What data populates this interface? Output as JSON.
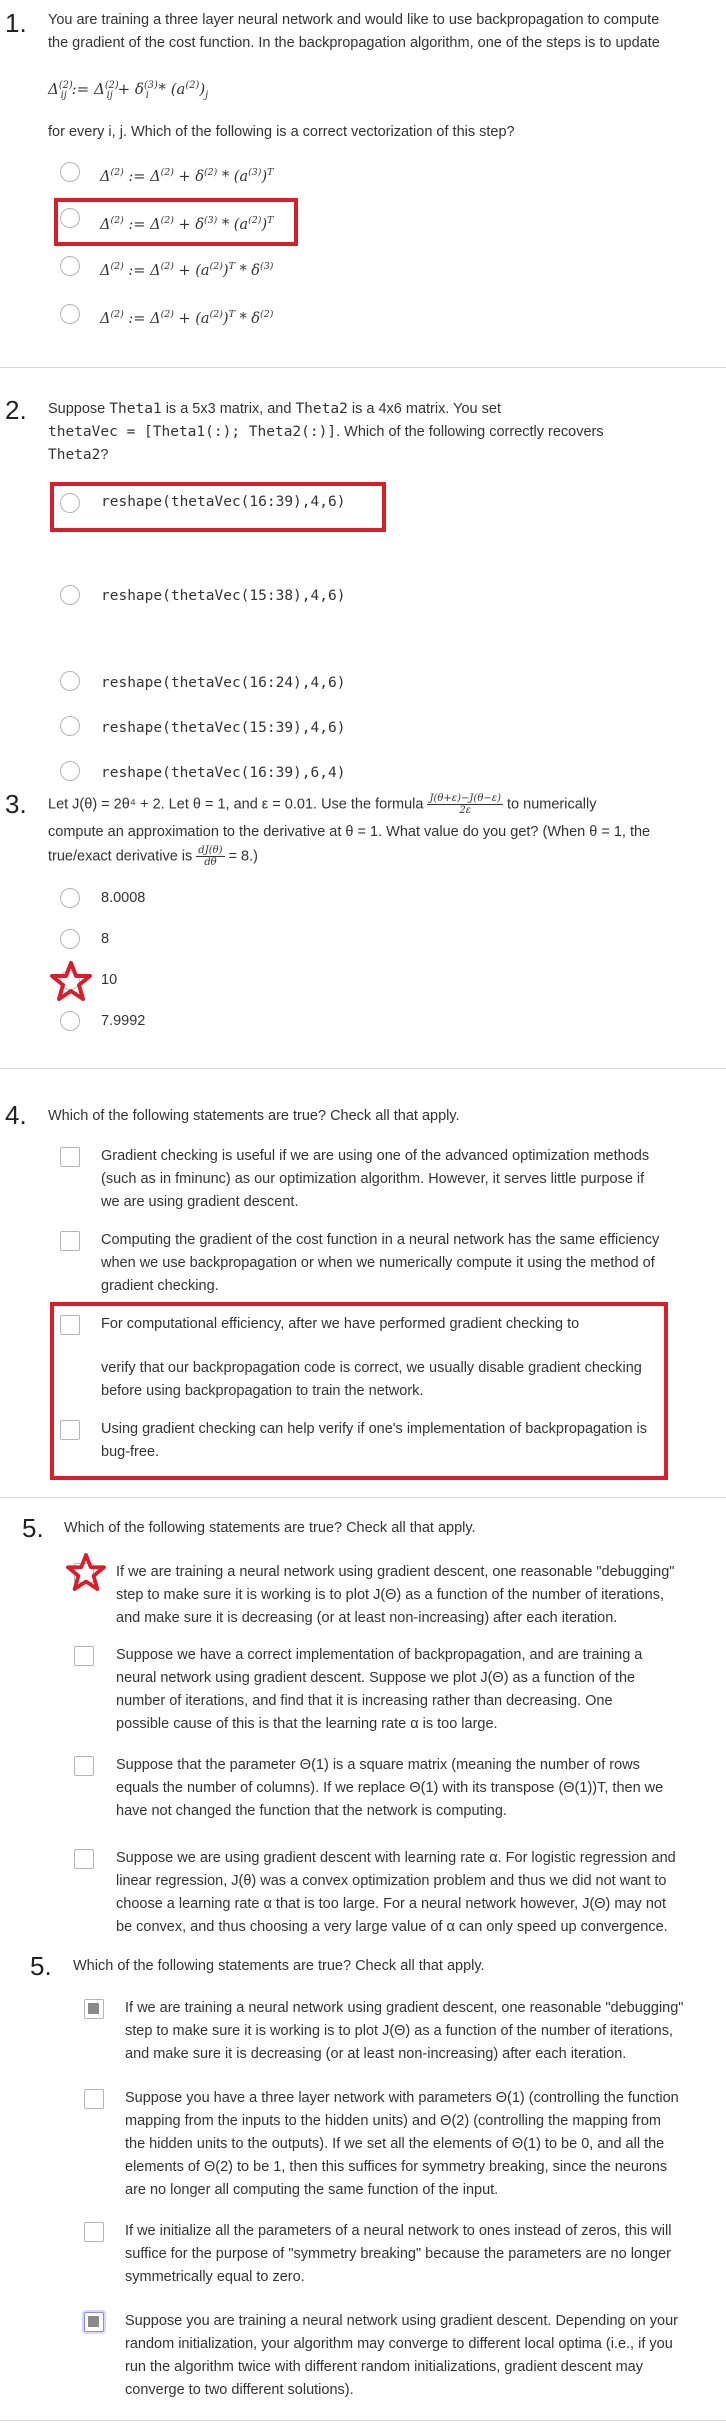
{
  "q1": {
    "number": "1.",
    "text_line1": "You are training a three layer neural network and would like to use backpropagation to compute",
    "text_line2": "the gradient of the cost function. In the backpropagation algorithm, one of the steps is to update",
    "formula": "Δij(2) := Δij(2) + δi(3) * (a(2))j",
    "prompt": "for every i, j. Which of the following is a correct vectorization of this step?",
    "options": [
      "Δ(2) := Δ(2) + δ(2) * (a(3))T",
      "Δ(2) := Δ(2) + δ(3) * (a(2))T",
      "Δ(2) := Δ(2) + (a(2))T * δ(3)",
      "Δ(2) := Δ(2) + (a(2))T * δ(2)"
    ]
  },
  "q2": {
    "number": "2.",
    "line1_a": "Suppose ",
    "line1_code1": "Theta1",
    "line1_b": " is a 5x3 matrix, and ",
    "line1_code2": "Theta2",
    "line1_c": " is a 4x6 matrix. You set",
    "line2_code": "thetaVec = [Theta1(:); Theta2(:)]",
    "line2_rest": ". Which of the following correctly recovers",
    "line3_code": "Theta2",
    "line3_rest": "?",
    "options": [
      "reshape(thetaVec(16:39),4,6)",
      "reshape(thetaVec(15:38),4,6)",
      "reshape(thetaVec(16:24),4,6)",
      "reshape(thetaVec(15:39),4,6)",
      "reshape(thetaVec(16:39),6,4)"
    ]
  },
  "q3": {
    "number": "3.",
    "line1_a": "Let J(θ) = 2θ⁴ + 2. Let θ = 1, and ε = 0.01. Use the formula",
    "line1_b": "to numerically",
    "line2": "compute an approximation to the derivative at θ = 1. What value do you get? (When θ = 1, the",
    "line3_a": "true/exact derivative is",
    "line3_b": "= 8.)",
    "options": [
      "8.0008",
      "8",
      "10",
      "7.9992"
    ]
  },
  "q4": {
    "number": "4.",
    "text": "Which of the following statements are true? Check all that apply.",
    "options": [
      [
        "Gradient checking is useful if we are using one of the advanced optimization methods",
        "(such as in fminunc) as our optimization algorithm. However, it serves little purpose if",
        "we are using gradient descent."
      ],
      [
        "Computing the gradient of the cost function in a neural network has the same efficiency",
        "when we use backpropagation or when we numerically compute it using the method of",
        "gradient checking."
      ],
      [
        "For computational efficiency, after we have performed gradient checking to"
      ],
      [
        "verify that our backpropagation code is correct, we usually disable gradient checking",
        "before using backpropagation to train the network."
      ],
      [
        "Using gradient checking can help verify if one's implementation of backpropagation is",
        "bug-free."
      ]
    ]
  },
  "q5a": {
    "number": "5.",
    "text": "Which of the following statements are true? Check all that apply.",
    "options": [
      [
        "If we are training a neural network using gradient descent, one reasonable \"debugging\"",
        "step to make sure it is working is to plot J(Θ) as a function of the number of iterations,",
        "and make sure it is decreasing (or at least non-increasing) after each iteration."
      ],
      [
        "Suppose we have a correct implementation of backpropagation, and are training a",
        "neural network using gradient descent. Suppose we plot J(Θ) as a function of the",
        "number of iterations, and find that it is increasing rather than decreasing. One",
        "possible cause of this is that the learning rate α is too large."
      ],
      [
        "Suppose that the parameter Θ(1) is a square matrix (meaning the number of rows",
        "equals the number of columns). If we replace Θ(1) with its transpose (Θ(1))T, then we",
        "have not changed the function that the network is computing."
      ],
      [
        "Suppose we are using gradient descent with learning rate α. For logistic regression and",
        "linear regression, J(θ) was a convex optimization problem and thus we did not want to",
        "choose a learning rate α that is too large. For a neural network however, J(Θ) may not",
        "be convex, and thus choosing a very large value of α can only speed up convergence."
      ]
    ]
  },
  "q5b": {
    "number": "5.",
    "text": "Which of the following statements are true? Check all that apply.",
    "options": [
      [
        "If we are training a neural network using gradient descent, one reasonable \"debugging\"",
        "step to make sure it is working is to plot J(Θ) as a function of the number of iterations,",
        "and make sure it is decreasing (or at least non-increasing) after each iteration."
      ],
      [
        "Suppose you have a three layer network with parameters Θ(1) (controlling the function",
        "mapping from the inputs to the hidden units) and Θ(2) (controlling the mapping from",
        "the hidden units to the outputs). If we set all the elements of Θ(1) to be 0, and all the",
        "elements of Θ(2) to be 1, then this suffices for symmetry breaking, since the neurons",
        "are no longer all computing the same function of the input."
      ],
      [
        "If we initialize all the parameters of a neural network to ones instead of zeros, this will",
        "suffice for the purpose of \"symmetry breaking\" because the parameters are no longer",
        "symmetrically equal to zero."
      ],
      [
        "Suppose you are training a neural network using gradient descent. Depending on your",
        "random initialization, your algorithm may converge to different local optima (i.e., if you",
        "run the algorithm twice with different random initializations, gradient descent may",
        "converge to two different solutions)."
      ]
    ]
  },
  "colors": {
    "highlight": "#d71f2b",
    "separator": "#d6d6d6",
    "checked": "#8a8a8a"
  }
}
